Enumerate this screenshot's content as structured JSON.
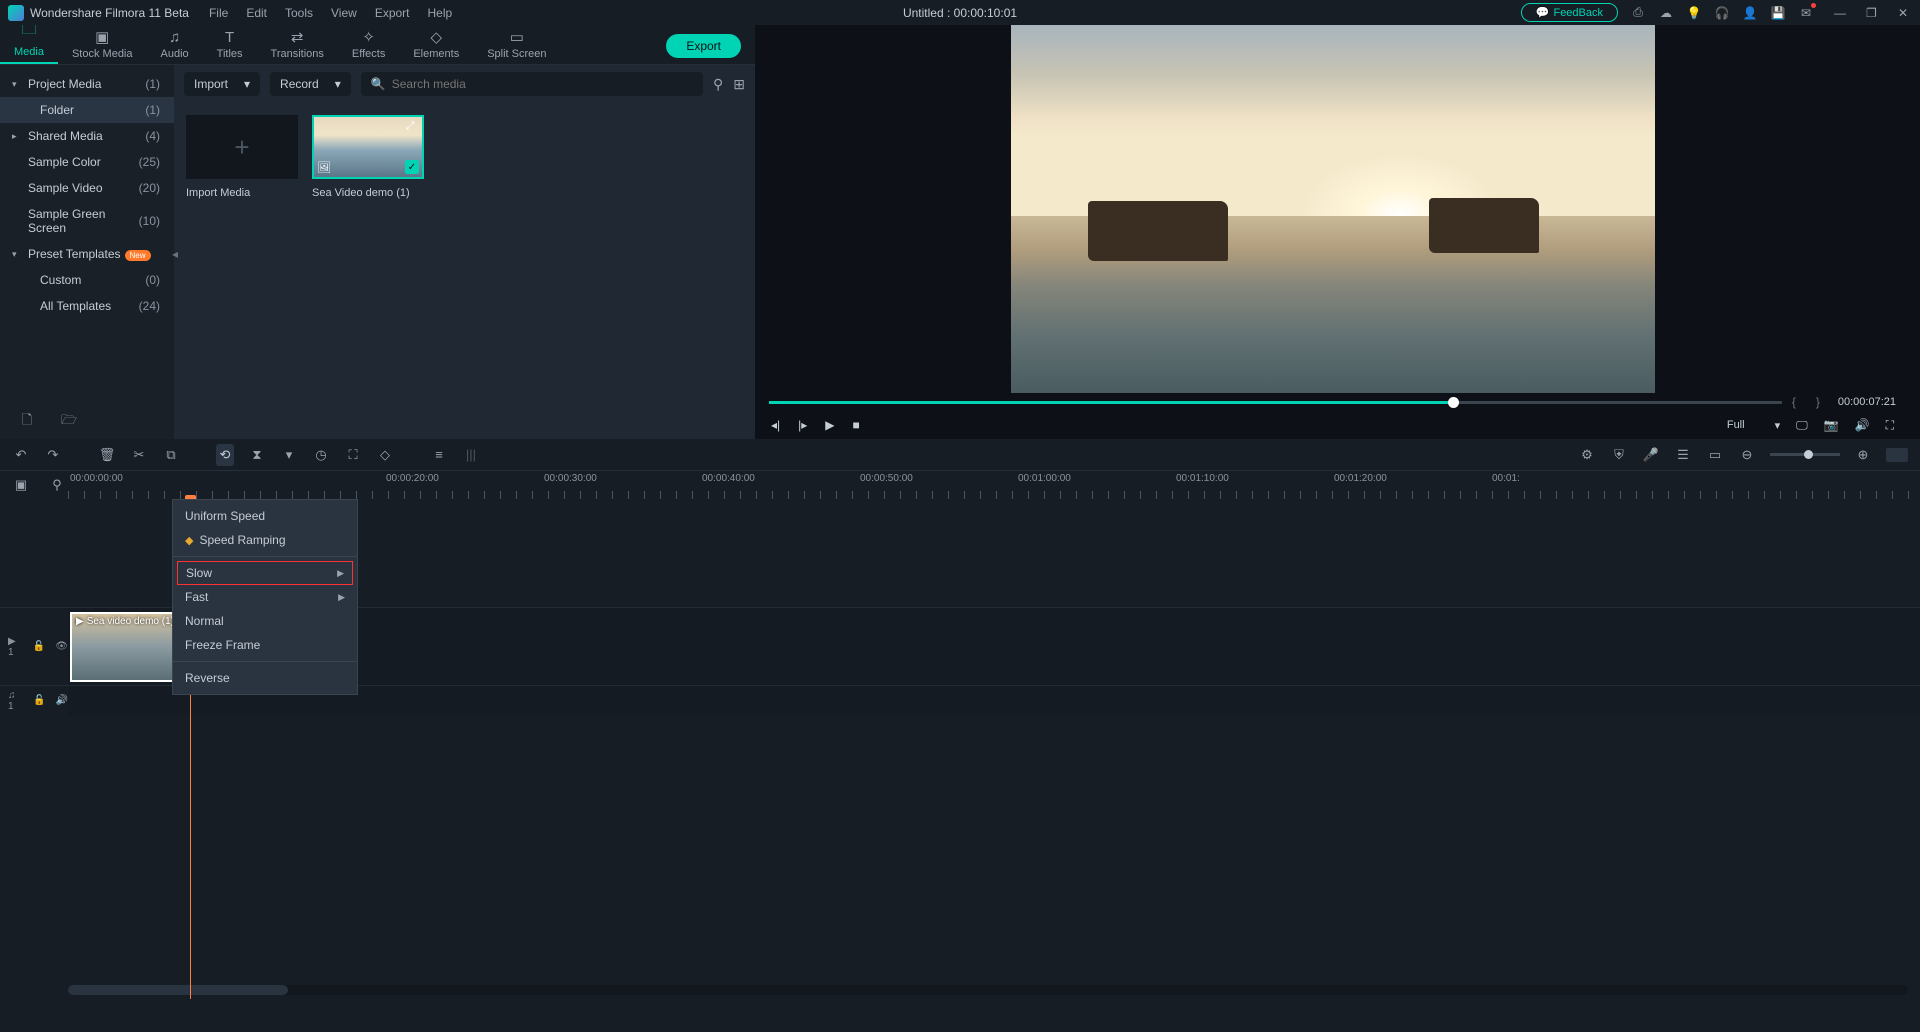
{
  "app": {
    "name": "Wondershare Filmora 11 Beta",
    "title": "Untitled : 00:00:10:01"
  },
  "menus": [
    "File",
    "Edit",
    "Tools",
    "View",
    "Export",
    "Help"
  ],
  "titlebar": {
    "feedback": "FeedBack"
  },
  "tabs": [
    {
      "label": "Media",
      "icon": "🗀"
    },
    {
      "label": "Stock Media",
      "icon": "▣"
    },
    {
      "label": "Audio",
      "icon": "♫"
    },
    {
      "label": "Titles",
      "icon": "T"
    },
    {
      "label": "Transitions",
      "icon": "⇄"
    },
    {
      "label": "Effects",
      "icon": "✧"
    },
    {
      "label": "Elements",
      "icon": "◇"
    },
    {
      "label": "Split Screen",
      "icon": "▭"
    }
  ],
  "export_label": "Export",
  "sidebar": {
    "items": [
      {
        "label": "Project Media",
        "count": "(1)",
        "arrow": "▾"
      },
      {
        "label": "Folder",
        "count": "(1)",
        "indent": true,
        "sel": true
      },
      {
        "label": "Shared Media",
        "count": "(4)",
        "arrow": "▸"
      },
      {
        "label": "Sample Color",
        "count": "(25)"
      },
      {
        "label": "Sample Video",
        "count": "(20)"
      },
      {
        "label": "Sample Green Screen",
        "count": "(10)"
      },
      {
        "label": "Preset Templates",
        "count": "",
        "arrow": "▾",
        "new": true
      },
      {
        "label": "Custom",
        "count": "(0)",
        "indent": true
      },
      {
        "label": "All Templates",
        "count": "(24)",
        "indent": true
      }
    ]
  },
  "content_toolbar": {
    "import": "Import",
    "record": "Record",
    "search_placeholder": "Search media"
  },
  "new_badge": "New",
  "media": {
    "import_label": "Import Media",
    "clip_label": "Sea Video demo (1)"
  },
  "playback": {
    "in_marker": "{",
    "out_marker": "}",
    "timecode": "00:00:07:21",
    "full": "Full"
  },
  "ruler": [
    "00:00:00:00",
    "00:00:20:00",
    "00:00:30:00",
    "00:00:40:00",
    "00:00:50:00",
    "00:01:00:00",
    "00:01:10:00",
    "00:01:20:00",
    "00:01:"
  ],
  "track_video": "▶ 1",
  "track_audio": "♫ 1",
  "clip_title": "Sea video demo (1)",
  "context_menu": {
    "uniform": "Uniform Speed",
    "ramping": "Speed Ramping",
    "slow": "Slow",
    "fast": "Fast",
    "normal": "Normal",
    "freeze": "Freeze Frame",
    "reverse": "Reverse"
  }
}
